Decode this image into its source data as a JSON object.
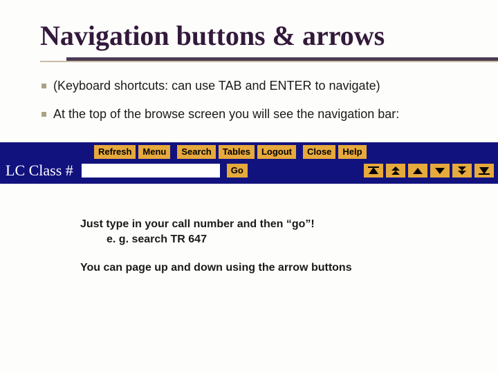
{
  "title": "Navigation buttons & arrows",
  "para1": "(Keyboard shortcuts: can use TAB and ENTER to navigate)",
  "para2": "At the top of the browse screen you will see the navigation bar:",
  "navbar": {
    "buttons": {
      "refresh": "Refresh",
      "menu": "Menu",
      "search": "Search",
      "tables": "Tables",
      "logout": "Logout",
      "close": "Close",
      "help": "Help",
      "go": "Go"
    },
    "lc_label": "LC Class #",
    "input_value": ""
  },
  "para3_line1": "Just type in your call number and then “go”!",
  "para3_line2": "e. g. search TR 647",
  "para4": "You can page up and down using the arrow buttons"
}
